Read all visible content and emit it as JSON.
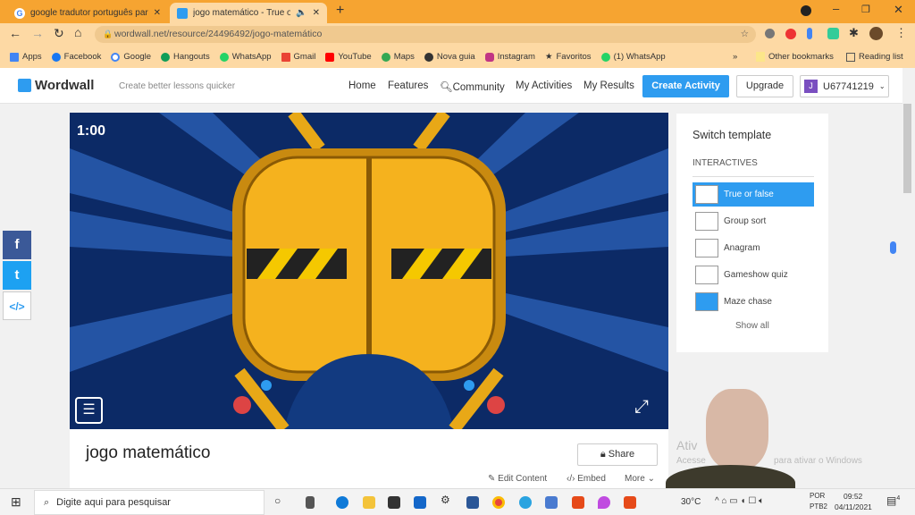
{
  "browser": {
    "tabs": [
      {
        "title": "google tradutor português para",
        "active": false
      },
      {
        "title": "jogo matemático - True or fa",
        "active": true
      }
    ],
    "url": "wordwall.net/resource/24496492/jogo-matemático",
    "bookmarks": [
      "Apps",
      "Facebook",
      "Google",
      "Hangouts",
      "WhatsApp",
      "Gmail",
      "YouTube",
      "Maps",
      "Nova guia",
      "Instagram",
      "Favoritos",
      "(1) WhatsApp"
    ],
    "other_bookmarks": "Other bookmarks",
    "reading_list": "Reading list"
  },
  "header": {
    "logo": "Wordwall",
    "tagline": "Create better lessons quicker",
    "nav": [
      "Home",
      "Features",
      "Community",
      "My Activities",
      "My Results"
    ],
    "create": "Create Activity",
    "upgrade": "Upgrade",
    "user": "U67741219",
    "avatar_letter": "J"
  },
  "game": {
    "timer": "1:00"
  },
  "activity": {
    "title": "jogo matemático",
    "share": "Share",
    "edit": "Edit Content",
    "embed": "Embed",
    "more": "More"
  },
  "sidebar": {
    "title": "Switch template",
    "section": "INTERACTIVES",
    "templates": [
      {
        "label": "True or false",
        "selected": true
      },
      {
        "label": "Group sort"
      },
      {
        "label": "Anagram"
      },
      {
        "label": "Gameshow quiz"
      },
      {
        "label": "Maze chase"
      }
    ],
    "show_all": "Show all"
  },
  "watermark": {
    "line1": "Ativ",
    "line2": "Acesse",
    "line3": "para ativar o Windows"
  },
  "taskbar": {
    "search": "Digite aqui para pesquisar",
    "temp": "30°C",
    "lang1": "POR",
    "lang2": "PTB2",
    "time": "09:52",
    "date": "04/11/2021",
    "notif": "4"
  },
  "colors": {
    "accent": "#2e9cf0",
    "chrome": "#f6a431",
    "door": "#f5b21e"
  }
}
